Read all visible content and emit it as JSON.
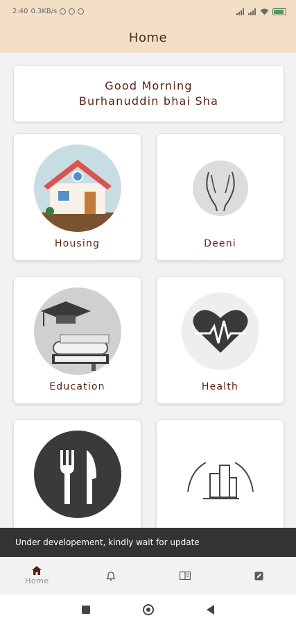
{
  "status_bar": {
    "time": "2:40",
    "network_speed": "0.3KB/s",
    "icons": [
      "alarm-icon",
      "whatsapp-icon",
      "notification-icon",
      "signal-icon",
      "signal-icon",
      "wifi-icon",
      "battery-icon"
    ],
    "battery_level": 0.85,
    "battery_color": "#3aa84b"
  },
  "app_bar": {
    "title": "Home",
    "background": "#f3dec6"
  },
  "greeting": {
    "line1": "Good Morning",
    "line2": "Burhanuddin bhai Sha"
  },
  "tiles": [
    {
      "label": "Housing",
      "icon": "house-icon"
    },
    {
      "label": "Deeni",
      "icon": "praying-hands-icon"
    },
    {
      "label": "Education",
      "icon": "graduation-cap-books-icon"
    },
    {
      "label": "Health",
      "icon": "heartbeat-icon"
    },
    {
      "label": "",
      "icon": "fork-knife-icon"
    },
    {
      "label": "",
      "icon": "hands-buildings-icon"
    }
  ],
  "snackbar": {
    "message": "Under developement, kindly wait for update"
  },
  "bottom_nav": [
    {
      "label": "Home",
      "icon": "home-icon",
      "active": true
    },
    {
      "label": "",
      "icon": "bell-icon",
      "active": false
    },
    {
      "label": "",
      "icon": "book-icon",
      "active": false
    },
    {
      "label": "",
      "icon": "edit-icon",
      "active": false
    }
  ],
  "colors": {
    "accent_brown": "#5a1f10",
    "header_beige": "#f3dec6",
    "snackbar": "#333333"
  }
}
